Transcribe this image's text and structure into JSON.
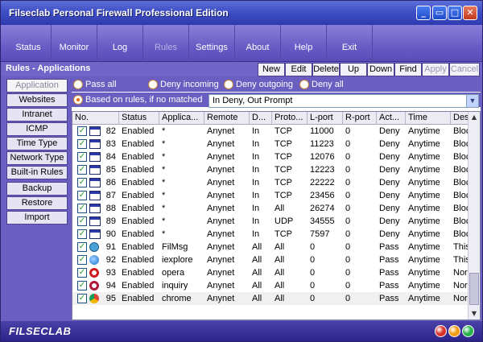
{
  "window": {
    "title": "Filseclab Personal Firewall Professional Edition"
  },
  "toolbar": {
    "items": [
      {
        "label": "Status"
      },
      {
        "label": "Monitor"
      },
      {
        "label": "Log"
      },
      {
        "label": "Rules"
      },
      {
        "label": "Settings"
      },
      {
        "label": "About"
      },
      {
        "label": "Help"
      },
      {
        "label": "Exit"
      }
    ]
  },
  "section": {
    "title": "Rules - Applications",
    "actions": [
      "New",
      "Edit",
      "Delete",
      "Up",
      "Down",
      "Find",
      "Apply",
      "Cancel"
    ]
  },
  "sidenav": {
    "items": [
      "Application",
      "Websites",
      "Intranet",
      "ICMP",
      "Time Type",
      "Network Type",
      "Built-in Rules",
      "Backup",
      "Restore",
      "Import"
    ]
  },
  "options": {
    "pass_all": "Pass all",
    "deny_incoming": "Deny incoming",
    "deny_outgoing": "Deny outgoing",
    "deny_all": "Deny all",
    "based_on_rules": "Based on rules, if no matched",
    "fallback_select": "In Deny, Out Prompt"
  },
  "grid": {
    "headers": [
      "No.",
      "Status",
      "Applica...",
      "Remote",
      "D...",
      "Proto...",
      "L-port",
      "R-port",
      "Act...",
      "Time",
      "Des"
    ],
    "rows": [
      {
        "no": "82",
        "status": "Enabled",
        "app": "*",
        "remote": "Anynet",
        "dir": "In",
        "proto": "TCP",
        "lport": "11000",
        "rport": "0",
        "action": "Deny",
        "time": "Anytime",
        "desc": "Bloc",
        "icon": "window"
      },
      {
        "no": "83",
        "status": "Enabled",
        "app": "*",
        "remote": "Anynet",
        "dir": "In",
        "proto": "TCP",
        "lport": "11223",
        "rport": "0",
        "action": "Deny",
        "time": "Anytime",
        "desc": "Bloc",
        "icon": "window"
      },
      {
        "no": "84",
        "status": "Enabled",
        "app": "*",
        "remote": "Anynet",
        "dir": "In",
        "proto": "TCP",
        "lport": "12076",
        "rport": "0",
        "action": "Deny",
        "time": "Anytime",
        "desc": "Bloc",
        "icon": "window"
      },
      {
        "no": "85",
        "status": "Enabled",
        "app": "*",
        "remote": "Anynet",
        "dir": "In",
        "proto": "TCP",
        "lport": "12223",
        "rport": "0",
        "action": "Deny",
        "time": "Anytime",
        "desc": "Bloc",
        "icon": "window"
      },
      {
        "no": "86",
        "status": "Enabled",
        "app": "*",
        "remote": "Anynet",
        "dir": "In",
        "proto": "TCP",
        "lport": "22222",
        "rport": "0",
        "action": "Deny",
        "time": "Anytime",
        "desc": "Bloc",
        "icon": "window"
      },
      {
        "no": "87",
        "status": "Enabled",
        "app": "*",
        "remote": "Anynet",
        "dir": "In",
        "proto": "TCP",
        "lport": "23456",
        "rport": "0",
        "action": "Deny",
        "time": "Anytime",
        "desc": "Bloc",
        "icon": "window"
      },
      {
        "no": "88",
        "status": "Enabled",
        "app": "*",
        "remote": "Anynet",
        "dir": "In",
        "proto": "All",
        "lport": "26274",
        "rport": "0",
        "action": "Deny",
        "time": "Anytime",
        "desc": "Bloc",
        "icon": "window"
      },
      {
        "no": "89",
        "status": "Enabled",
        "app": "*",
        "remote": "Anynet",
        "dir": "In",
        "proto": "UDP",
        "lport": "34555",
        "rport": "0",
        "action": "Deny",
        "time": "Anytime",
        "desc": "Bloc",
        "icon": "window"
      },
      {
        "no": "90",
        "status": "Enabled",
        "app": "*",
        "remote": "Anynet",
        "dir": "In",
        "proto": "TCP",
        "lport": "7597",
        "rport": "0",
        "action": "Deny",
        "time": "Anytime",
        "desc": "Bloc",
        "icon": "window"
      },
      {
        "no": "91",
        "status": "Enabled",
        "app": "FilMsg",
        "remote": "Anynet",
        "dir": "All",
        "proto": "All",
        "lport": "0",
        "rport": "0",
        "action": "Pass",
        "time": "Anytime",
        "desc": "This",
        "icon": "filmsg"
      },
      {
        "no": "92",
        "status": "Enabled",
        "app": "iexplore",
        "remote": "Anynet",
        "dir": "All",
        "proto": "All",
        "lport": "0",
        "rport": "0",
        "action": "Pass",
        "time": "Anytime",
        "desc": "This",
        "icon": "ie"
      },
      {
        "no": "93",
        "status": "Enabled",
        "app": "opera",
        "remote": "Anynet",
        "dir": "All",
        "proto": "All",
        "lport": "0",
        "rport": "0",
        "action": "Pass",
        "time": "Anytime",
        "desc": "Nor",
        "icon": "opera"
      },
      {
        "no": "94",
        "status": "Enabled",
        "app": "inquiry",
        "remote": "Anynet",
        "dir": "All",
        "proto": "All",
        "lport": "0",
        "rport": "0",
        "action": "Pass",
        "time": "Anytime",
        "desc": "Nor",
        "icon": "inquiry"
      },
      {
        "no": "95",
        "status": "Enabled",
        "app": "chrome",
        "remote": "Anynet",
        "dir": "All",
        "proto": "All",
        "lport": "0",
        "rport": "0",
        "action": "Pass",
        "time": "Anytime",
        "desc": "Nor",
        "icon": "chrome"
      }
    ]
  },
  "footer": {
    "brand": "FILSECLAB"
  },
  "colors": {
    "lamp_red": "#d8322a",
    "lamp_orange": "#f29a12",
    "lamp_green": "#26b34a"
  }
}
